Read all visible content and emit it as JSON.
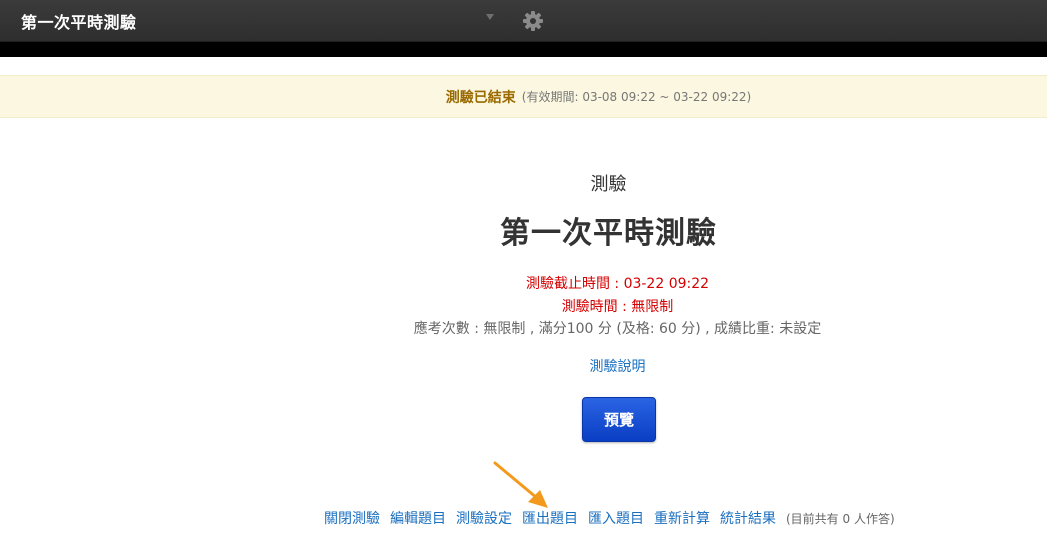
{
  "header": {
    "title": "第一次平時測驗",
    "icons": [
      "chevron-down-icon",
      "gear-icon"
    ]
  },
  "notice": {
    "status": "測驗已結束",
    "period": "(有效期間: 03-08 09:22 ~ 03-22 09:22)"
  },
  "quiz": {
    "type_label": "測驗",
    "title": "第一次平時測驗",
    "deadline": "測驗截止時間 : 03-22 09:22",
    "duration": "測驗時間 : 無限制",
    "attempts": "應考次數 : 無限制 , 滿分100 分 (及格: 60 分) , 成績比重: 未設定",
    "description_link": "測驗說明",
    "preview_button": "預覽"
  },
  "actions": {
    "close": "關閉測驗",
    "edit": "編輯題目",
    "settings": "測驗設定",
    "export": "匯出題目",
    "import": "匯入題目",
    "recalculate": "重新計算",
    "stats": "統計結果",
    "count": "(目前共有 0 人作答)"
  },
  "colors": {
    "topbar": "#333333",
    "notice_bg": "#fbf7e0",
    "notice_status": "#9a6a00",
    "warning_text": "#d40000",
    "link": "#1a6fbf",
    "button": "#1450d6",
    "arrow": "#f39a1e"
  }
}
